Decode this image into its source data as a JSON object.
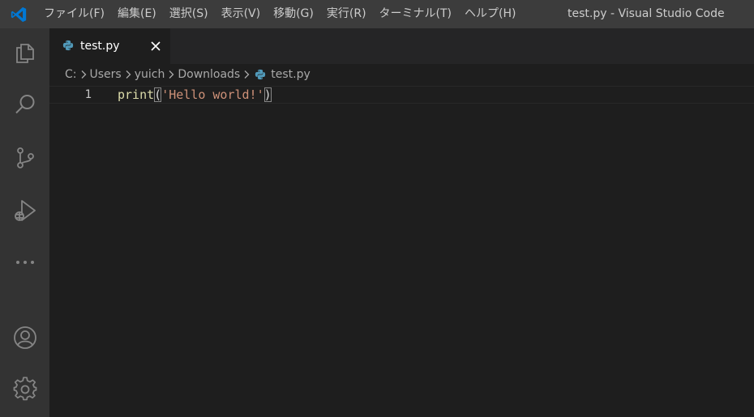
{
  "window": {
    "title": "test.py - Visual Studio Code"
  },
  "menu": {
    "items": [
      "ファイル(F)",
      "編集(E)",
      "選択(S)",
      "表示(V)",
      "移動(G)",
      "実行(R)",
      "ターミナル(T)",
      "ヘルプ(H)"
    ]
  },
  "activity_bar": {
    "icons": [
      "explorer-icon",
      "search-icon",
      "source-control-icon",
      "run-debug-icon",
      "more-icon",
      "account-icon",
      "settings-gear-icon"
    ]
  },
  "tab": {
    "label": "test.py"
  },
  "breadcrumb": {
    "parts": [
      "C:",
      "Users",
      "yuich",
      "Downloads",
      "test.py"
    ]
  },
  "editor": {
    "line_number": "1",
    "code": {
      "function": "print",
      "open_paren": "(",
      "string": "'Hello world!'",
      "close_paren": ")"
    }
  },
  "colors": {
    "titlebar": "#3c3c3c",
    "activitybar": "#333333",
    "editor_bg": "#1e1e1e",
    "vscode_blue": "#0078d4",
    "function": "#dcdcaa",
    "string": "#ce9178",
    "python_blue": "#519aba"
  }
}
